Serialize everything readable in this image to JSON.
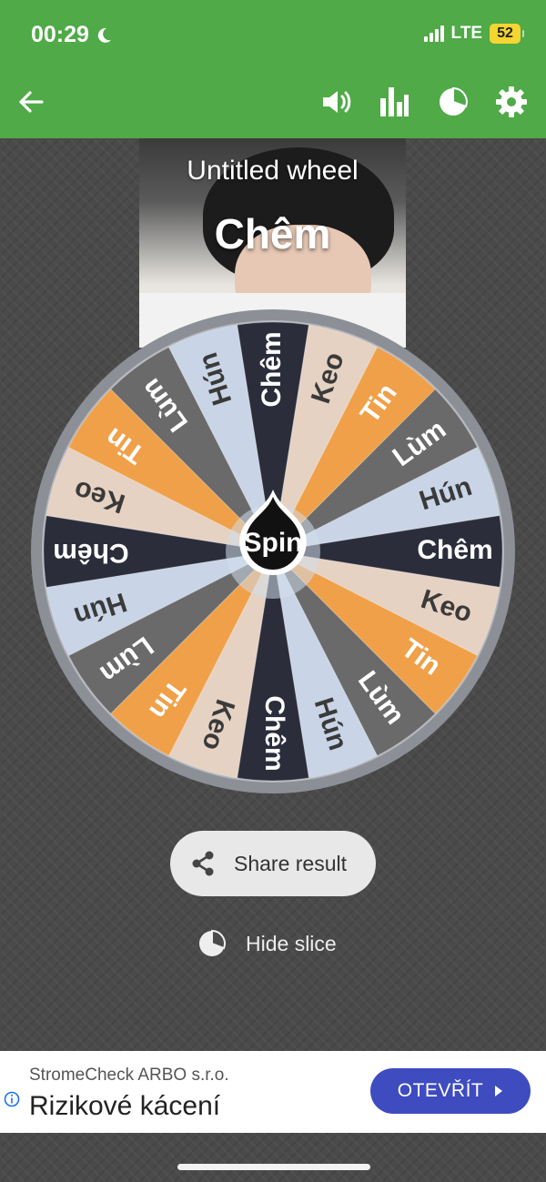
{
  "status_bar": {
    "time": "00:29",
    "network": "LTE",
    "battery": "52",
    "icons": [
      "moon-icon",
      "signal-icon",
      "battery-icon"
    ]
  },
  "toolbar": {
    "icons": [
      "back-arrow-icon",
      "sound-icon",
      "stats-icon",
      "pie-chart-icon",
      "gear-icon"
    ]
  },
  "wheel": {
    "title": "Untitled wheel",
    "result": "Chêm",
    "spin_label": "Spin",
    "slices": [
      "Chêm",
      "Keo",
      "Tin",
      "Lùm",
      "Hún",
      "Chêm",
      "Keo",
      "Tin",
      "Lùm",
      "Hún",
      "Chêm",
      "Keo",
      "Tin",
      "Lùm",
      "Hún",
      "Chêm",
      "Keo",
      "Tin",
      "Lùm",
      "Hún"
    ],
    "slice_colors": [
      "#2b2d3b",
      "#e6d2c2",
      "#f0a048",
      "#6a6a6a",
      "#c9d5e6",
      "#2b2d3b",
      "#e6d2c2",
      "#f0a048",
      "#6a6a6a",
      "#c9d5e6",
      "#2b2d3b",
      "#e6d2c2",
      "#f0a048",
      "#6a6a6a",
      "#c9d5e6",
      "#2b2d3b",
      "#e6d2c2",
      "#f0a048",
      "#6a6a6a",
      "#c9d5e6"
    ]
  },
  "actions": {
    "share_label": "Share result",
    "hide_slice_label": "Hide slice"
  },
  "ad": {
    "sponsor": "StromeCheck ARBO s.r.o.",
    "headline": "Rizikové kácení",
    "cta": "OTEVŘÍT"
  }
}
